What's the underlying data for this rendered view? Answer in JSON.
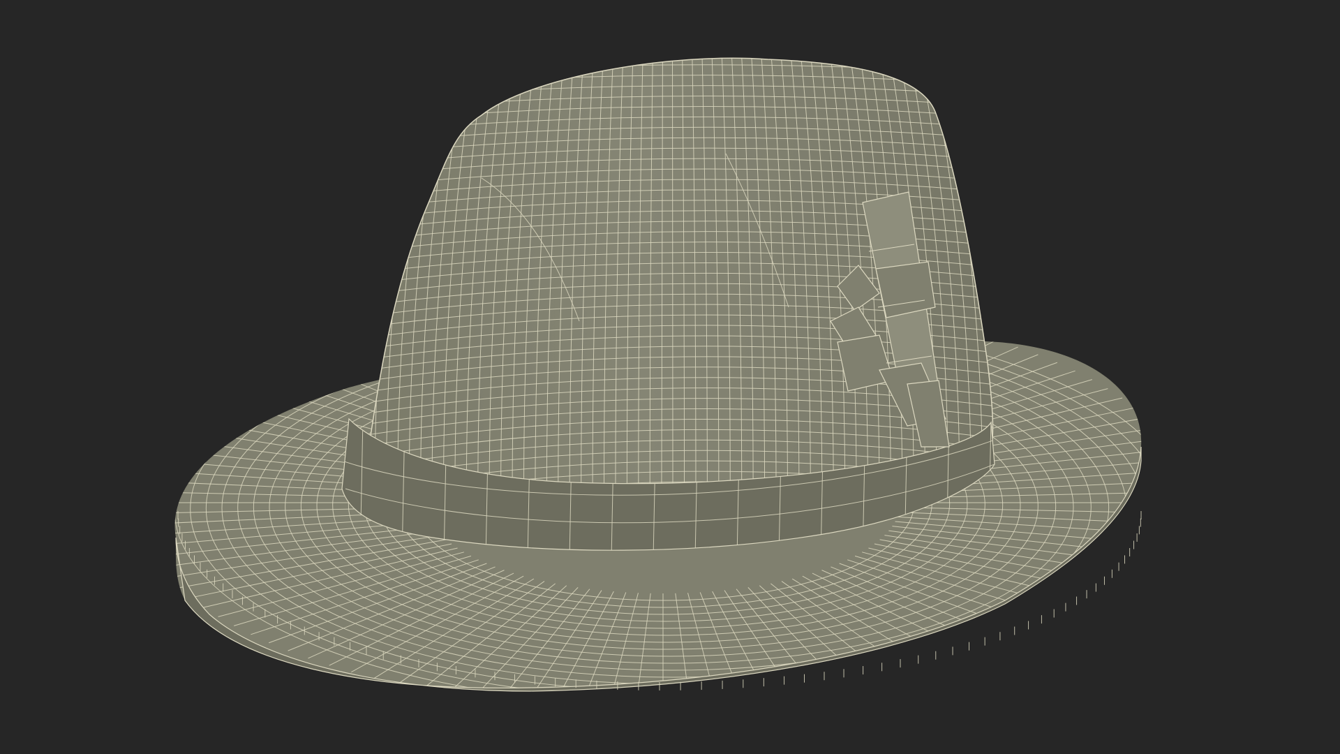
{
  "scene": {
    "subject": "fedora-hat-wireframe",
    "icon": "hat-wireframe-render"
  },
  "colors": {
    "background": "#262626",
    "surface": "#80806f",
    "surface_dark": "#6d6d5e",
    "surface_light": "#8e8e7c",
    "wire": "#dcd8c0",
    "shadow": "#55554a"
  }
}
